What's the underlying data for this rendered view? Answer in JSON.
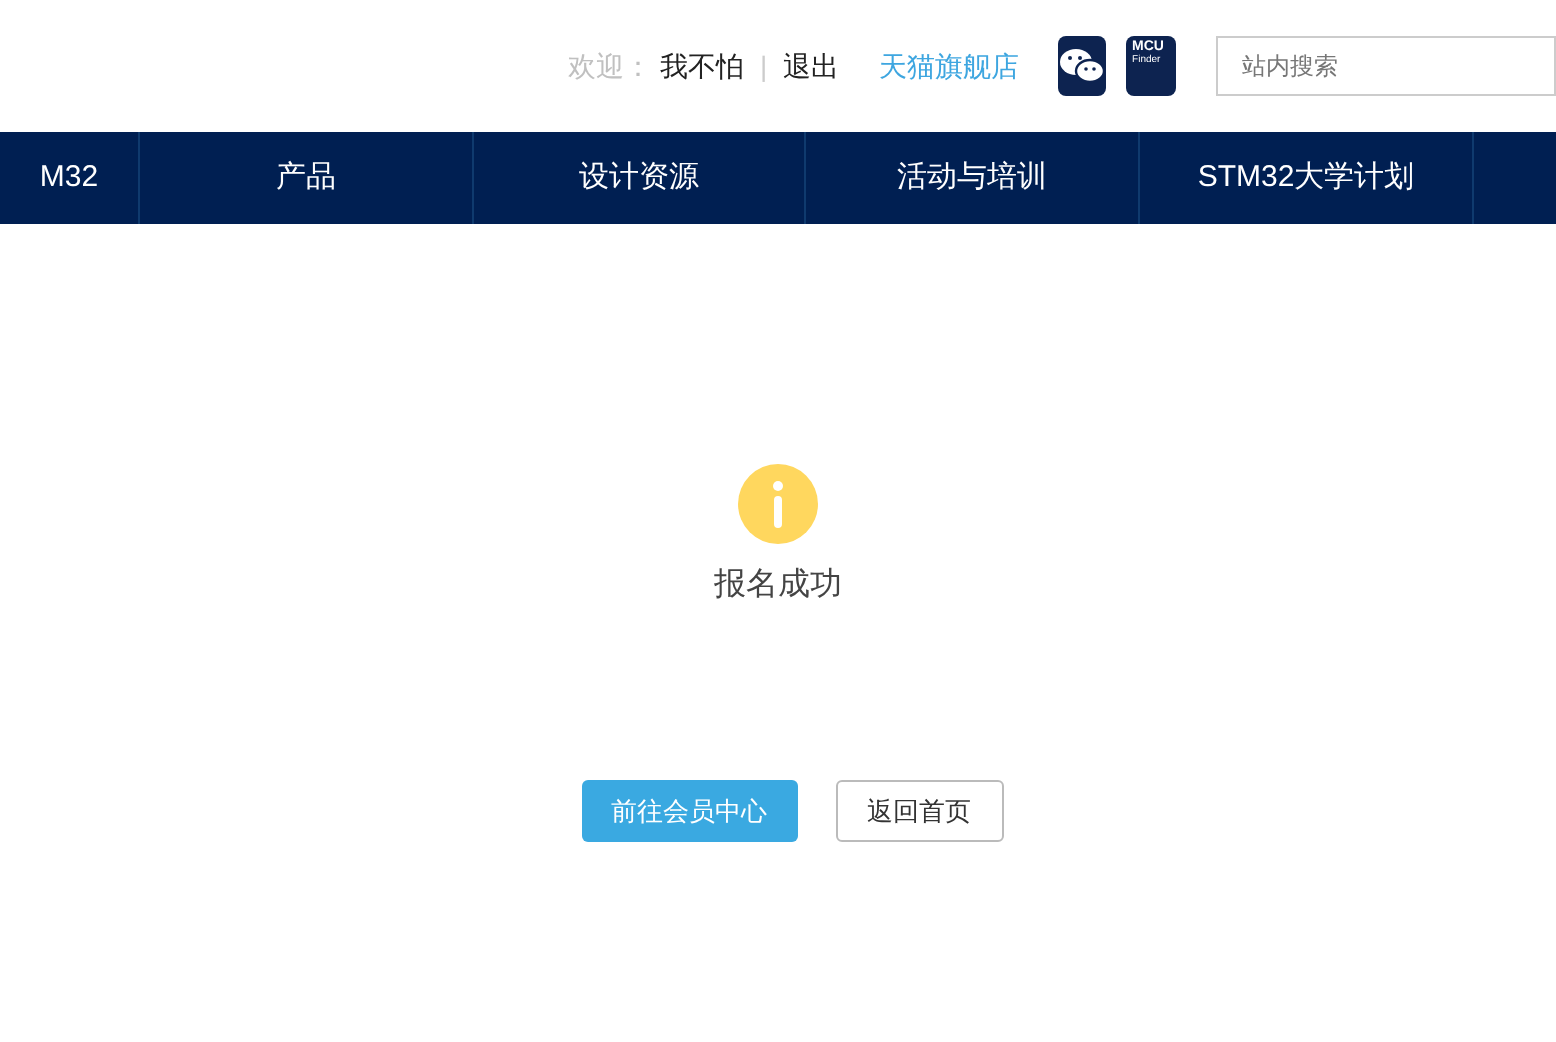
{
  "top_bar": {
    "welcome_label": "欢迎：",
    "username": "我不怕",
    "separator": "|",
    "logout": "退出",
    "store_link": "天猫旗舰店",
    "app_badge": {
      "line_1": "MCU",
      "line_2": "Finder"
    },
    "search": {
      "placeholder": "站内搜索"
    }
  },
  "nav": {
    "items": [
      {
        "label": "M32"
      },
      {
        "label": "产品"
      },
      {
        "label": "设计资源"
      },
      {
        "label": "活动与培训"
      },
      {
        "label": "STM32大学计划"
      }
    ]
  },
  "message": {
    "kind": "info",
    "text": "报名成功"
  },
  "buttons": [
    {
      "label": "前往会员中心",
      "kind": "primary"
    },
    {
      "label": "返回首页",
      "kind": "secondary"
    }
  ]
}
